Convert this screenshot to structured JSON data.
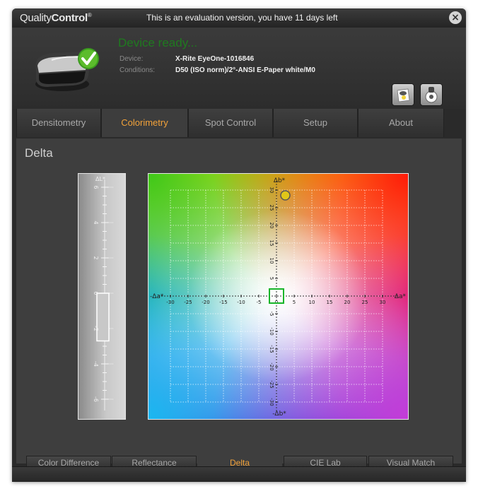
{
  "app": {
    "logo_part1": "Quality",
    "logo_part2": "Control",
    "logo_mark": "®",
    "eval_message": "This is an evaluation version, you have 11 days left",
    "close_glyph": "×"
  },
  "device": {
    "status": "Device ready...",
    "device_label": "Device:",
    "device_value": "X-Rite EyeOne-1016846",
    "conditions_label": "Conditions:",
    "conditions_value": "D50 (ISO norm)/2°-ANSI E-Paper white/M0"
  },
  "toolbar": {
    "icons": [
      "paper-white-icon",
      "spot-measure-icon"
    ]
  },
  "tabs": [
    {
      "label": "Densitometry",
      "active": false
    },
    {
      "label": "Colorimetry",
      "active": true
    },
    {
      "label": "Spot Control",
      "active": false
    },
    {
      "label": "Setup",
      "active": false
    },
    {
      "label": "About",
      "active": false
    }
  ],
  "section": {
    "title": "Delta"
  },
  "delta_l": {
    "axis_label": "ΔL*",
    "ticks": [
      "6",
      "4",
      "2",
      "0",
      "-2",
      "-4",
      "-6"
    ],
    "value": -2.7
  },
  "ab_plot": {
    "top_label": "Δb*",
    "bottom_label": "-Δb*",
    "left_label": "-Δa*",
    "right_label": "Δa*",
    "x_ticks": [
      "-30",
      "-25",
      "-20",
      "-15",
      "-10",
      "-5",
      "0",
      "5",
      "10",
      "15",
      "20",
      "25",
      "30"
    ],
    "y_ticks": [
      "30",
      "25",
      "20",
      "15",
      "10",
      "5",
      "-5",
      "-10",
      "-15",
      "-20",
      "-25",
      "-30"
    ],
    "sample": {
      "da": 2.5,
      "db": 28.5
    },
    "tolerance_box_half_width": 2
  },
  "subtabs": [
    {
      "label": "Color Difference",
      "active": false
    },
    {
      "label": "Reflectance",
      "active": false
    },
    {
      "label": "Delta",
      "active": true
    },
    {
      "label": "CIE Lab",
      "active": false
    },
    {
      "label": "Visual Match",
      "active": false
    }
  ],
  "colors": {
    "accent": "#f2a23a",
    "status_green": "#1f7a1f",
    "tolerance_box": "#18b52a",
    "sample_marker": "#e0c619"
  }
}
